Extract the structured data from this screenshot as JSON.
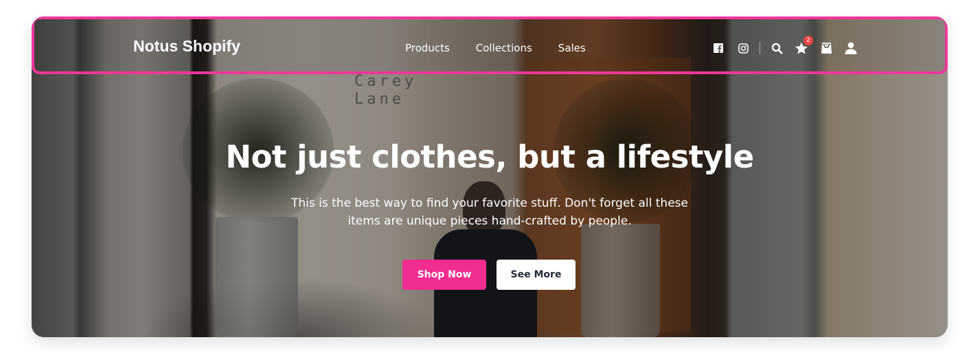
{
  "navbar": {
    "brand": "Notus Shopify",
    "links": [
      {
        "label": "Products"
      },
      {
        "label": "Collections"
      },
      {
        "label": "Sales"
      }
    ],
    "icons": {
      "facebook": "facebook-icon",
      "instagram": "instagram-icon",
      "search": "search-icon",
      "favorites": "star-icon",
      "bag": "shopping-bag-icon",
      "account": "user-icon"
    },
    "favorites_badge": "2",
    "highlight_color": "#f2379c"
  },
  "background_sign": {
    "line1": "Carey",
    "line2": "Lane"
  },
  "hero": {
    "headline": "Not just clothes, but a lifestyle",
    "subtitle": "This is the best way to find your favorite stuff. Don't forget all these items are unique pieces hand-crafted by people.",
    "primary_button": "Shop Now",
    "secondary_button": "See More"
  },
  "colors": {
    "primary": "#f12d8f",
    "badge": "#ef4444",
    "text_on_image": "#ffffff",
    "secondary_button_text": "#1f2937"
  }
}
